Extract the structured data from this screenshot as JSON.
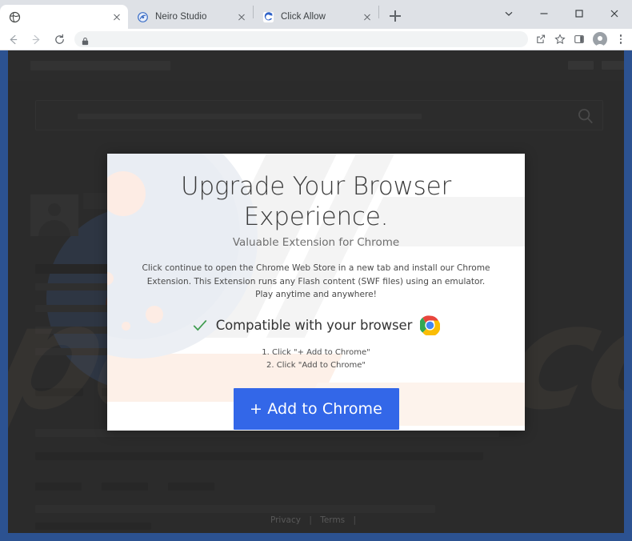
{
  "browser": {
    "tabs": [
      {
        "title": "",
        "favicon": "globe-icon",
        "active": true
      },
      {
        "title": "Neiro Studio",
        "favicon": "neiro-studio-favicon",
        "active": false
      },
      {
        "title": "Click Allow",
        "favicon": "click-allow-favicon",
        "active": false
      }
    ],
    "new_tab_label": "+",
    "window_controls": {
      "search_tabs": "chevron-down-icon",
      "minimize": "minimize-icon",
      "maximize": "maximize-icon",
      "close": "close-icon"
    },
    "toolbar": {
      "back": "back-arrow-icon",
      "forward": "forward-arrow-icon",
      "reload": "reload-icon",
      "lock": "lock-icon",
      "url_value": "",
      "url_placeholder": "",
      "share": "share-icon",
      "bookmark": "star-icon",
      "side_panel": "side-panel-icon",
      "profile": "profile-avatar",
      "menu": "three-dot-menu-icon"
    }
  },
  "background_page": {
    "logo_placeholder": "",
    "nav_items": [
      "",
      "",
      ""
    ],
    "search_placeholder": "",
    "search_icon": "search-icon",
    "watermark_text": "pcrisk.com"
  },
  "modal": {
    "headline": "Upgrade Your Browser Experience.",
    "subheadline": "Valuable Extension for Chrome",
    "body": "Click continue to open the Chrome Web Store in a new tab and install our Chrome Extension. This Extension runs any Flash content (SWF files) using an emulator. Play anytime and anywhere!",
    "compatibility": {
      "check_icon": "green-check-icon",
      "label": "Compatible with your browser",
      "browser_logo": "chrome-logo-icon"
    },
    "steps": [
      "1. Click \"+ Add to Chrome\"",
      "2. Click \"Add to Chrome\""
    ],
    "cta_label": "+ Add to Chrome",
    "cta_color": "#3367e8"
  },
  "footer": {
    "privacy_label": "Privacy",
    "terms_label": "Terms",
    "divider": "|"
  },
  "colors": {
    "accent_blue": "#3367e8",
    "tabstrip_bg": "#dee1e6",
    "window_frame": "#2c5291",
    "page_dim": "#3a3a3a",
    "check_green": "#3f9c4f"
  }
}
